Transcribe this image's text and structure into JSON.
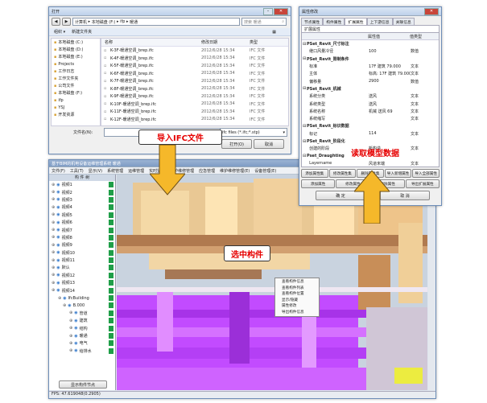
{
  "open_dialog": {
    "title": "打开",
    "breadcrumb": [
      "计算机",
      "本地磁盘 (F:)",
      "ifp",
      "暖通"
    ],
    "search_placeholder": "搜索 暖通",
    "toolbar": {
      "organize": "组织 ▾",
      "new_folder": "新建文件夹"
    },
    "nav_items": [
      "本地磁盘 (C:)",
      "本地磁盘 (D:)",
      "本地磁盘 (E:)",
      "Projects",
      "工作日志",
      "工作文件夹",
      "公司文件",
      "本地磁盘 (F:)",
      "ifp",
      "YSJ",
      "开发资源"
    ],
    "columns": [
      "名称",
      "修改日期",
      "类型"
    ],
    "files": [
      {
        "name": "K-3F-暖通空调_brep.ifc",
        "date": "2012/6/28 15:34",
        "type": "IFC 文件"
      },
      {
        "name": "K-4F-暖通空调_brep.ifc",
        "date": "2012/6/28 15:34",
        "type": "IFC 文件"
      },
      {
        "name": "K-5F-暖通空调_brep.ifc",
        "date": "2012/6/28 15:34",
        "type": "IFC 文件"
      },
      {
        "name": "K-6F-暖通空调_brep.ifc",
        "date": "2012/6/28 15:34",
        "type": "IFC 文件"
      },
      {
        "name": "K-7F-暖通空调_brep.ifc",
        "date": "2012/6/28 15:34",
        "type": "IFC 文件"
      },
      {
        "name": "K-8F-暖通空调_brep.ifc",
        "date": "2012/6/28 15:34",
        "type": "IFC 文件"
      },
      {
        "name": "K-9F-暖通空调_brep.ifc",
        "date": "2012/6/28 15:34",
        "type": "IFC 文件"
      },
      {
        "name": "K-10F-暖通空调_brep.ifc",
        "date": "2012/6/28 15:34",
        "type": "IFC 文件"
      },
      {
        "name": "K-11F-暖通空调_brep.ifc",
        "date": "2012/6/28 15:34",
        "type": "IFC 文件"
      },
      {
        "name": "K-12F-暖通空调_brep.ifc",
        "date": "2012/6/28 15:34",
        "type": "IFC 文件"
      }
    ],
    "filename_label": "文件名(N):",
    "filter_value": "ifc files (*.ifc;*.stp)",
    "open_button": "打开(O)",
    "cancel_button": "取消"
  },
  "props_dialog": {
    "title": "属性修改",
    "tabs": [
      "节点属性",
      "构件属性",
      "扩展属性",
      "上下游信息",
      "关联信息"
    ],
    "active_tab": 2,
    "section_label": "扩展属性",
    "columns": [
      "",
      "属性值",
      "值类型"
    ],
    "rows": [
      {
        "name": "PSet_Revit_尺寸标注",
        "value": "",
        "type": "",
        "group": true
      },
      {
        "name": "  继口风量冷径",
        "value": "100",
        "type": "数值",
        "group": false
      },
      {
        "name": "PSet_Revit_限制条件",
        "value": "",
        "type": "",
        "group": true
      },
      {
        "name": "  标准",
        "value": "17F 建筑 79.000",
        "type": "文本",
        "group": false
      },
      {
        "name": "  主体",
        "value": "标高: 17F 建筑 79.000",
        "type": "文本",
        "group": false
      },
      {
        "name": "  偏移量",
        "value": "2900",
        "type": "数值",
        "group": false
      },
      {
        "name": "PSet_Revit_机械",
        "value": "",
        "type": "",
        "group": true
      },
      {
        "name": "  系统分类",
        "value": "送风",
        "type": "文本",
        "group": false
      },
      {
        "name": "  系统类型",
        "value": "送风",
        "type": "文本",
        "group": false
      },
      {
        "name": "  系统名称",
        "value": "机械 送风 69",
        "type": "文本",
        "group": false
      },
      {
        "name": "  系统缩写",
        "value": "",
        "type": "文本",
        "group": false
      },
      {
        "name": "PSet_Revit_标识数据",
        "value": "",
        "type": "",
        "group": true
      },
      {
        "name": "  标记",
        "value": "114",
        "type": "文本",
        "group": false
      },
      {
        "name": "PSet_Revit_阶段化",
        "value": "",
        "type": "",
        "group": true
      },
      {
        "name": "  创建的阶段",
        "value": "新构造",
        "type": "文本",
        "group": false
      },
      {
        "name": "Pset_Draughting",
        "value": "",
        "type": "",
        "group": true
      },
      {
        "name": "  Layername",
        "value": "风道末端",
        "type": "文本",
        "group": false
      }
    ],
    "buttons_row1": [
      "添加属性集",
      "修改属性集",
      "删除属性集",
      "导入新增属性",
      "导入全部属性"
    ],
    "buttons_row2": [
      "添加属性",
      "修改属性",
      "删除属性",
      "导出扩展属性"
    ],
    "ok_button": "确 定",
    "cancel_button": "取 消"
  },
  "main_app": {
    "title": "基于BIM的机电设备运维管理系统 暖通",
    "menu": [
      "文件(F)",
      "工具(T)",
      "显示(V)",
      "系统管理",
      "运维管理",
      "实时监控",
      "维护维修管理",
      "应急管理",
      "维护维修管理(E)",
      "设备管理(E)"
    ],
    "tree_header": "构 件 树",
    "tree_items": [
      "视频1",
      "视频2",
      "视频3",
      "视频4",
      "视频5",
      "视频6",
      "视频7",
      "视频8",
      "视频9",
      "视频10",
      "视频11",
      "默认",
      "视频12",
      "视频13",
      "视频14",
      "IfcBuilding",
      "B.000",
      "管道",
      "建筑",
      "结构",
      "暖通",
      "电气",
      "给排水"
    ],
    "bottom_button": "显示构件节点",
    "status": "FPS: 47.619048(0.2905)",
    "context_menu": [
      "查看构件信息",
      "查看构件列表",
      "查看构件位置",
      "显示/隐藏",
      "属性修改",
      "导出构件信息"
    ]
  },
  "annotations": {
    "import": "导入IFC文件",
    "read": "读取模型数据",
    "select": "选中构件"
  },
  "colors": {
    "arrow": "#f5b82a",
    "callout_text": "#e60000",
    "pipe_purple": "#c24bff",
    "duct_beige": "#f4d39b"
  }
}
